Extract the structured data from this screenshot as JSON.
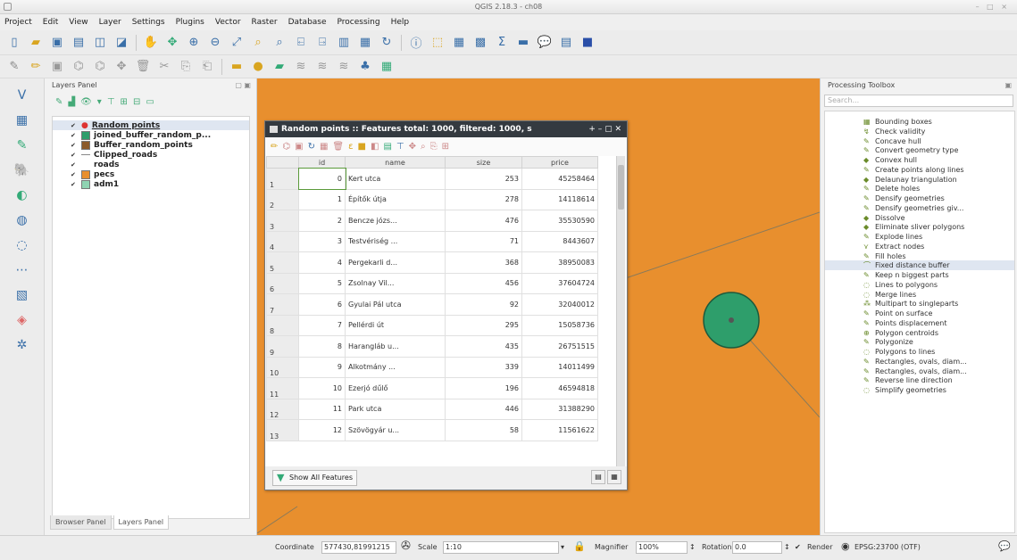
{
  "window": {
    "title": "QGIS 2.18.3 - ch08"
  },
  "menu": [
    "Project",
    "Edit",
    "View",
    "Layer",
    "Settings",
    "Plugins",
    "Vector",
    "Raster",
    "Database",
    "Processing",
    "Help"
  ],
  "toolbar_icons_1": [
    "new-project-icon",
    "open-project-icon",
    "save-project-icon",
    "save-as-icon",
    "new-print-composer-icon",
    "composer-manager-icon",
    "pan-icon",
    "pan-to-selection-icon",
    "zoom-in-icon",
    "zoom-out-icon",
    "zoom-full-icon",
    "zoom-selection-icon",
    "zoom-layer-icon",
    "zoom-last-icon",
    "zoom-next-icon",
    "new-bookmark-icon",
    "show-bookmarks-icon",
    "refresh-icon",
    "identify-icon",
    "select-features-icon",
    "open-table-icon",
    "field-calculator-icon",
    "statistics-icon",
    "measure-icon",
    "tooltip-icon",
    "text-annotation-icon",
    "help-icon"
  ],
  "toolbar_icons_2": [
    "current-edits-icon",
    "toggle-editing-icon",
    "save-edits-icon",
    "digitize-icon",
    "node-tool-icon",
    "move-feature-icon",
    "delete-selected-icon",
    "cut-icon",
    "copy-icon",
    "paste-icon",
    "label-icon",
    "pin-label-icon",
    "show-hide-label-icon",
    "move-label-icon",
    "rotate-label-icon",
    "change-label-icon",
    "python-icon",
    "plugin-icon"
  ],
  "left_tools": [
    "add-vector-layer-icon",
    "add-raster-layer-icon",
    "add-delimited-text-icon",
    "add-postgis-icon",
    "add-spatialite-icon",
    "add-wms-icon",
    "add-wcs-icon",
    "add-wfs-icon",
    "new-shapefile-icon",
    "new-spatialite-icon",
    "add-virtual-layer-icon"
  ],
  "layers_panel": {
    "title": "Layers Panel",
    "layers": [
      {
        "name": "Random points",
        "color": "#d33333",
        "kind": "point",
        "selected": true
      },
      {
        "name": "joined_buffer_random_p...",
        "color": "#2e9e6b",
        "kind": "polygon"
      },
      {
        "name": "Buffer_random_points",
        "color": "#8b5a2b",
        "kind": "polygon"
      },
      {
        "name": "Clipped_roads",
        "color": "#888888",
        "kind": "line"
      },
      {
        "name": "roads",
        "color": "",
        "kind": "none"
      },
      {
        "name": "pecs",
        "color": "#e88f2e",
        "kind": "polygon"
      },
      {
        "name": "adm1",
        "color": "#8fd3b2",
        "kind": "polygon"
      }
    ],
    "tabs": [
      "Browser Panel",
      "Layers Panel"
    ]
  },
  "attribute_table": {
    "title": "Random points :: Features total: 1000, filtered: 1000, s",
    "columns": [
      "id",
      "name",
      "size",
      "price"
    ],
    "rows": [
      {
        "rn": "1",
        "id": "0",
        "name": "Kert utca",
        "size": "253",
        "price": "45258464"
      },
      {
        "rn": "2",
        "id": "1",
        "name": "Építők útja",
        "size": "278",
        "price": "14118614"
      },
      {
        "rn": "3",
        "id": "2",
        "name": "Bencze józs...",
        "size": "476",
        "price": "35530590"
      },
      {
        "rn": "4",
        "id": "3",
        "name": "Testvériség ...",
        "size": "71",
        "price": "8443607"
      },
      {
        "rn": "5",
        "id": "4",
        "name": "Pergekarli d...",
        "size": "368",
        "price": "38950083"
      },
      {
        "rn": "6",
        "id": "5",
        "name": "Zsolnay Vil...",
        "size": "456",
        "price": "37604724"
      },
      {
        "rn": "7",
        "id": "6",
        "name": "Gyulai Pál utca",
        "size": "92",
        "price": "32040012"
      },
      {
        "rn": "8",
        "id": "7",
        "name": "Pellérdi út",
        "size": "295",
        "price": "15058736"
      },
      {
        "rn": "9",
        "id": "8",
        "name": "Harangláb u...",
        "size": "435",
        "price": "26751515"
      },
      {
        "rn": "10",
        "id": "9",
        "name": "Alkotmány ...",
        "size": "339",
        "price": "14011499"
      },
      {
        "rn": "11",
        "id": "10",
        "name": "Ezerjó dűlő",
        "size": "196",
        "price": "46594818"
      },
      {
        "rn": "12",
        "id": "11",
        "name": "Park utca",
        "size": "446",
        "price": "31388290"
      },
      {
        "rn": "13",
        "id": "12",
        "name": "Szövögyár u...",
        "size": "58",
        "price": "11561622"
      }
    ],
    "show_all_label": "Show All Features"
  },
  "toolbox": {
    "title": "Processing Toolbox",
    "search_placeholder": "Search...",
    "items": [
      "Bounding boxes",
      "Check validity",
      "Concave hull",
      "Convert geometry type",
      "Convex hull",
      "Create points along lines",
      "Delaunay triangulation",
      "Delete holes",
      "Densify geometries",
      "Densify geometries giv...",
      "Dissolve",
      "Eliminate sliver polygons",
      "Explode lines",
      "Extract nodes",
      "Fill holes",
      "Fixed distance buffer",
      "Keep n biggest parts",
      "Lines to polygons",
      "Merge lines",
      "Multipart to singleparts",
      "Point on surface",
      "Points displacement",
      "Polygon centroids",
      "Polygonize",
      "Polygons to lines",
      "Rectangles, ovals, diam...",
      "Rectangles, ovals, diam...",
      "Reverse line direction",
      "Simplify geometries"
    ],
    "selected_index": 15
  },
  "statusbar": {
    "coordinate_label": "Coordinate",
    "coordinate_value": "577430,81991215",
    "scale_label": "Scale",
    "scale_value": "1:10",
    "magnifier_label": "Magnifier",
    "magnifier_value": "100%",
    "rotation_label": "Rotation",
    "rotation_value": "0.0",
    "render_label": "Render",
    "crs_label": "EPSG:23700 (OTF)"
  },
  "colors": {
    "map_bg": "#e88f2e",
    "buffer_fill": "#2e9e6b",
    "table_header": "#343a40"
  }
}
